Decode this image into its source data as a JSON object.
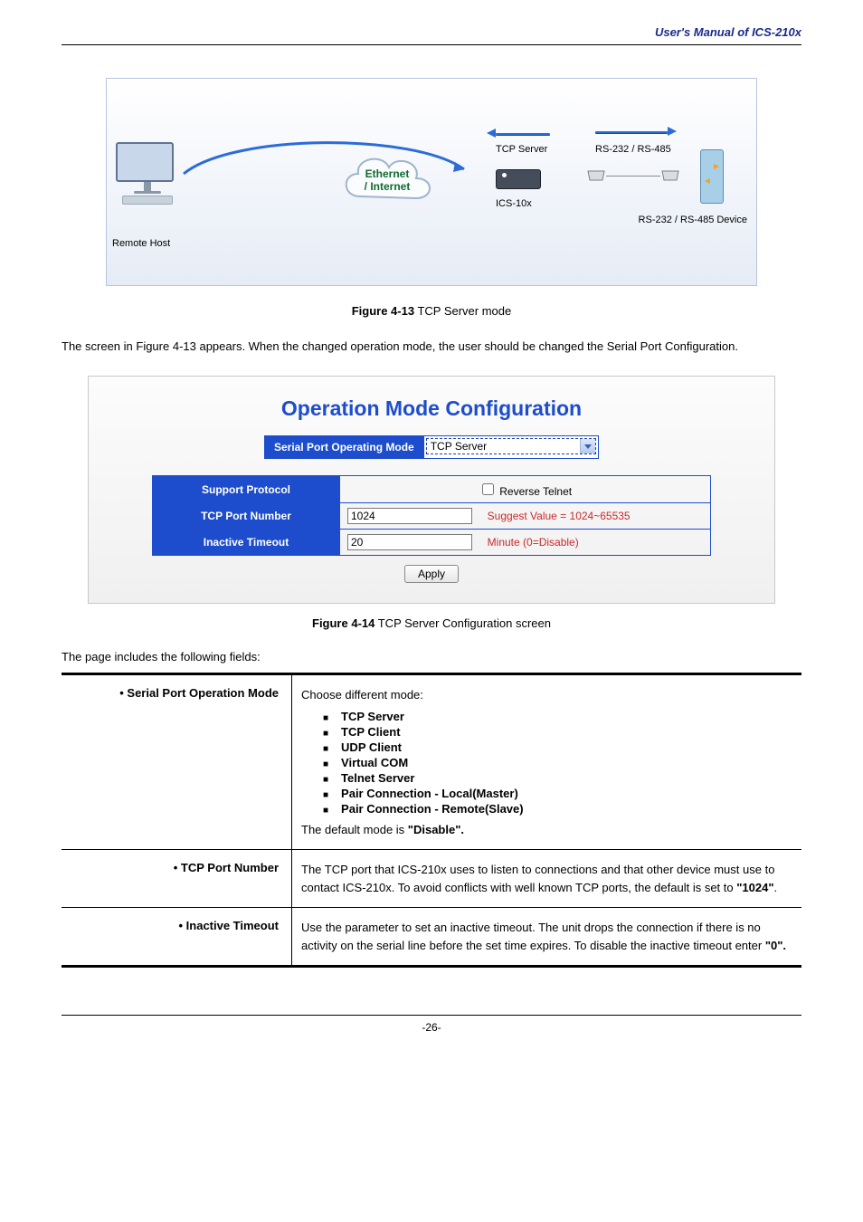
{
  "header": {
    "title": "User's Manual of ICS-210x"
  },
  "diagram": {
    "remote_host_label": "Remote Host",
    "cloud_label_line1": "Ethernet",
    "cloud_label_line2": "/ Internet",
    "tcp_server_label": "TCP Server",
    "ics_label": "ICS-10x",
    "rs_label": "RS-232 / RS-485",
    "rs_device_label": "RS-232 / RS-485 Device"
  },
  "fig413": {
    "bold": "Figure 4-13",
    "rest": " TCP Server mode"
  },
  "para1": "The screen in Figure 4-13 appears. When the changed operation mode, the user should be changed the Serial Port Configuration.",
  "config": {
    "title": "Operation Mode Configuration",
    "mode_label": "Serial Port Operating Mode",
    "mode_value": "TCP Server",
    "rows": {
      "support_protocol": {
        "label": "Support Protocol",
        "checkbox_label": "Reverse Telnet"
      },
      "tcp_port": {
        "label": "TCP Port Number",
        "value": "1024",
        "hint": "Suggest Value = 1024~65535"
      },
      "inactive": {
        "label": "Inactive Timeout",
        "value": "20",
        "hint": "Minute (0=Disable)"
      }
    },
    "apply_label": "Apply"
  },
  "fig414": {
    "bold": "Figure 4-14",
    "rest": " TCP Server Configuration screen"
  },
  "fields_intro": "The page includes the following fields:",
  "fields": {
    "row1": {
      "name": "Serial Port Operation Mode",
      "intro": "Choose different mode:",
      "items": [
        "TCP Server",
        "TCP Client",
        "UDP Client",
        "Virtual COM",
        "Telnet Server",
        "Pair Connection - Local(Master)",
        "Pair Connection - Remote(Slave)"
      ],
      "outro_pre": "The default mode is ",
      "outro_bold": "\"Disable\"."
    },
    "row2": {
      "name": "TCP Port Number",
      "desc_pre": "The TCP port that ICS-210x uses to listen to connections and that other device must use to contact ICS-210x. To avoid conflicts with well known TCP ports, the default is set to ",
      "desc_bold": "\"1024\"",
      "desc_post": "."
    },
    "row3": {
      "name": "Inactive Timeout",
      "desc_pre": "Use the parameter to set an inactive timeout. The unit drops the connection if there is no activity on the serial line before the set time expires. To disable the inactive timeout enter ",
      "desc_bold": "\"0\"."
    }
  },
  "footer": {
    "page": "-26-"
  }
}
